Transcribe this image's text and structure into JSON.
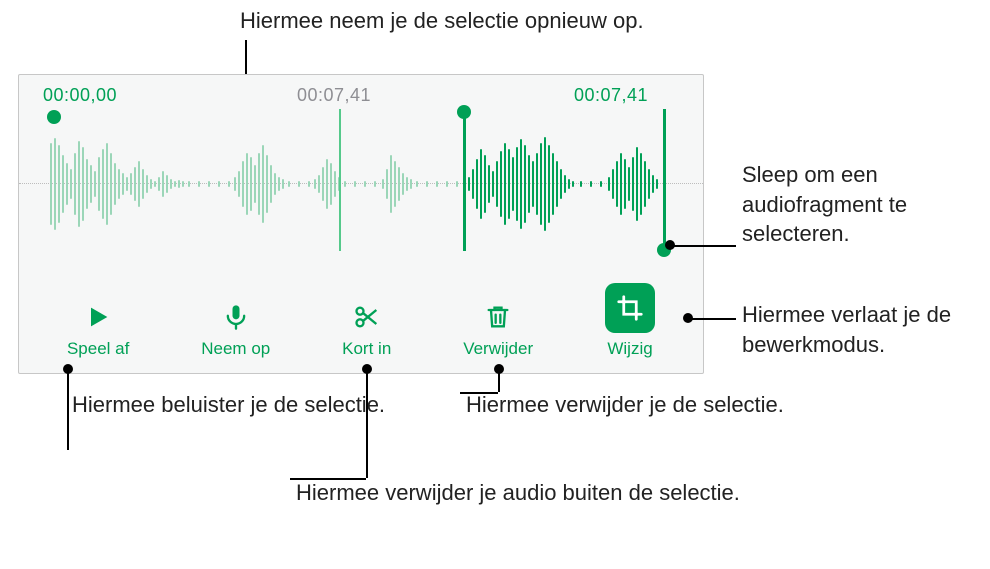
{
  "callouts": {
    "rerecord": "Hiermee neem je de selectie opnieuw op.",
    "dragSelect": "Sleep om een audiofragment te selecteren.",
    "exitEdit": "Hiermee verlaat je de bewerkmodus.",
    "listen": "Hiermee beluister je de selectie.",
    "delete": "Hiermee verwijder je de selectie.",
    "trim": "Hiermee verwijder je audio buiten de selectie."
  },
  "times": {
    "start": "00:00,00",
    "playhead": "00:07,41",
    "end": "00:07,41"
  },
  "toolbar": {
    "play": "Speel af",
    "record": "Neem op",
    "trim": "Kort in",
    "delete": "Verwijder",
    "edit": "Wijzig"
  }
}
